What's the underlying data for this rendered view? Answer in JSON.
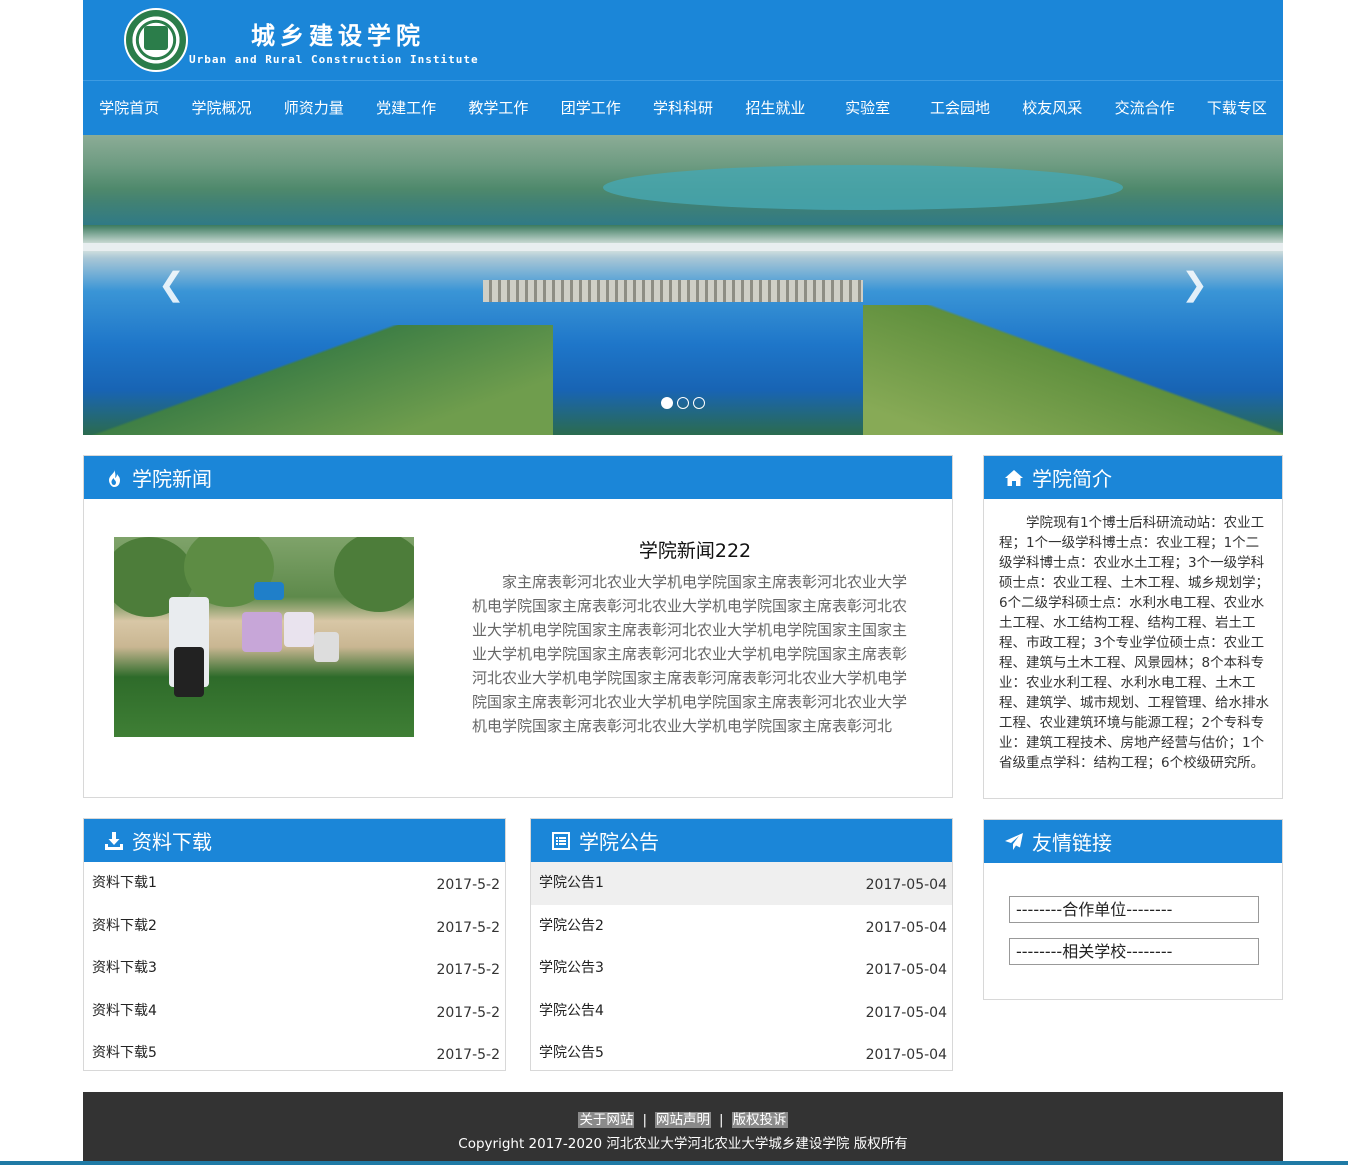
{
  "header": {
    "title_cn": "城乡建设学院",
    "title_en": "Urban and Rural Construction Institute"
  },
  "nav": [
    "学院首页",
    "学院概况",
    "师资力量",
    "党建工作",
    "教学工作",
    "团学工作",
    "学科科研",
    "招生就业",
    "实验室",
    "工会园地",
    "校友风采",
    "交流合作",
    "下载专区"
  ],
  "banner": {
    "prev_glyph": "❮",
    "next_glyph": "❯",
    "slide_count": 3,
    "active_slide": 1
  },
  "news": {
    "heading": "学院新闻",
    "title": "学院新闻222",
    "body": "家主席表彰河北农业大学机电学院国家主席表彰河北农业大学机电学院国家主席表彰河北农业大学机电学院国家主席表彰河北农业大学机电学院国家主席表彰河北农业大学机电学院国家主国家主业大学机电学院国家主席表彰河北农业大学机电学院国家主席表彰河北农业大学机电学院国家主席表彰河席表彰河北农业大学机电学院国家主席表彰河北农业大学机电学院国家主席表彰河北农业大学机电学院国家主席表彰河北农业大学机电学院国家主席表彰河北"
  },
  "intro": {
    "heading": "学院简介",
    "body": "学院现有1个博士后科研流动站：农业工程；1个一级学科博士点：农业工程；1个二级学科博士点：农业水土工程；3个一级学科硕士点：农业工程、土木工程、城乡规划学；6个二级学科硕士点：水利水电工程、农业水土工程、水工结构工程、结构工程、岩土工程、市政工程；3个专业学位硕士点：农业工程、建筑与土木工程、风景园林；8个本科专业：农业水利工程、水利水电工程、土木工程、建筑学、城市规划、工程管理、给水排水工程、农业建筑环境与能源工程；2个专科专业：建筑工程技术、房地产经营与估价；1个省级重点学科：结构工程；6个校级研究所。"
  },
  "downloads": {
    "heading": "资料下载",
    "items": [
      {
        "title": "资料下载1",
        "date": "2017-5-2"
      },
      {
        "title": "资料下载2",
        "date": "2017-5-2"
      },
      {
        "title": "资料下载3",
        "date": "2017-5-2"
      },
      {
        "title": "资料下载4",
        "date": "2017-5-2"
      },
      {
        "title": "资料下载5",
        "date": "2017-5-2"
      }
    ]
  },
  "notices": {
    "heading": "学院公告",
    "items": [
      {
        "title": "学院公告1",
        "date": "2017-05-04"
      },
      {
        "title": "学院公告2",
        "date": "2017-05-04"
      },
      {
        "title": "学院公告3",
        "date": "2017-05-04"
      },
      {
        "title": "学院公告4",
        "date": "2017-05-04"
      },
      {
        "title": "学院公告5",
        "date": "2017-05-04"
      }
    ]
  },
  "links": {
    "heading": "友情链接",
    "select1": "--------合作单位--------",
    "select2": "--------相关学校--------"
  },
  "footer": {
    "links": [
      "关于网站",
      "网站声明",
      "版权投诉"
    ],
    "separator": "|",
    "copyright": "Copyright 2017-2020 河北农业大学河北农业大学城乡建设学院 版权所有"
  },
  "colors": {
    "brand_blue": "#1b86d8",
    "footer_bg": "#333333"
  },
  "icons": {
    "news": "flame-icon",
    "intro": "home-icon",
    "downloads": "download-icon",
    "notices": "list-icon",
    "links": "send-icon"
  }
}
